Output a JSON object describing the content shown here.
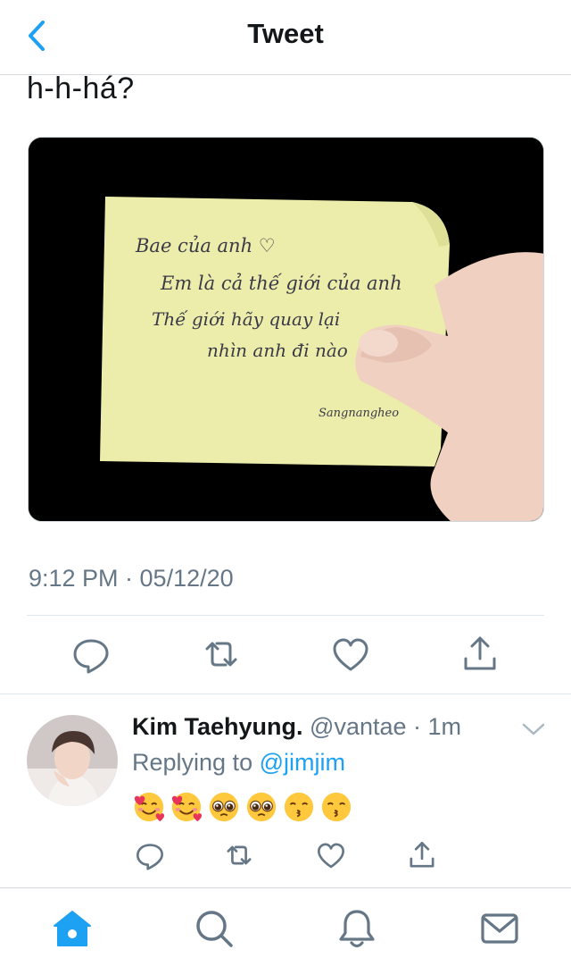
{
  "header": {
    "title": "Tweet",
    "back_icon": "chevron-left-icon",
    "accent": "#1da1f2"
  },
  "tweet": {
    "text": "h-h-há?",
    "timestamp": "9:12 PM · 05/12/20",
    "photo": {
      "note_lines": [
        "Bae của anh ♡",
        "Em là cả thế giới của anh",
        "Thế giới hãy quay lại",
        "nhìn anh đi nào"
      ],
      "signature": "Sangnangheo"
    },
    "actions": [
      "reply-icon",
      "retweet-icon",
      "like-icon",
      "share-icon"
    ]
  },
  "reply": {
    "name": "Kim Taehyung.",
    "handle": "@vantae · 1m",
    "replying_prefix": "Replying to ",
    "replying_to": "@jimjim",
    "emojis": [
      "smiling-face-with-hearts",
      "smiling-face-with-hearts",
      "pleading-face",
      "pleading-face",
      "kissing-face-smiling-eyes",
      "kissing-face-smiling-eyes"
    ],
    "actions": [
      "reply-icon",
      "retweet-icon",
      "like-icon",
      "share-icon"
    ]
  },
  "tabbar": {
    "items": [
      "home-icon",
      "search-icon",
      "notifications-icon",
      "messages-icon"
    ],
    "active": "home-icon"
  },
  "colors": {
    "text": "#14171a",
    "secondary": "#657786",
    "accent": "#1da1f2",
    "divider": "#e1e8ed"
  }
}
